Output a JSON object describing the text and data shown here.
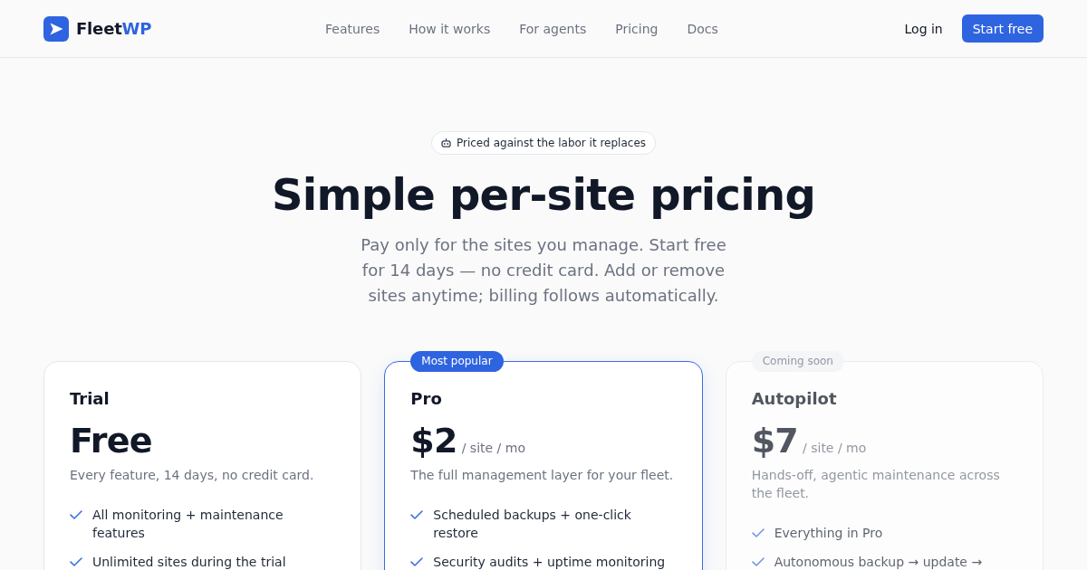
{
  "header": {
    "brand": {
      "name": "Fleet",
      "accent": "WP"
    },
    "nav_links": [
      "Features",
      "How it works",
      "For agents",
      "Pricing",
      "Docs"
    ],
    "login": "Log in",
    "cta": "Start free"
  },
  "hero": {
    "badge": "Priced against the labor it replaces",
    "title": "Simple per-site pricing",
    "subtitle": "Pay only for the sites you manage. Start free for 14 days — no credit card. Add or remove sites anytime; billing follows automatically."
  },
  "plans": [
    {
      "name": "Trial",
      "price": "Free",
      "description": "Every feature, 14 days, no credit card.",
      "featured": false,
      "dimmed": false,
      "features": [
        "All monitoring + maintenance features",
        "Unlimited sites during the trial"
      ]
    },
    {
      "name": "Pro",
      "badge": {
        "text": "Most popular",
        "kind": "accent"
      },
      "price": "$2",
      "period": "/ site / mo",
      "description": "The full management layer for your fleet.",
      "featured": true,
      "dimmed": false,
      "features": [
        "Scheduled backups + one-click restore",
        "Security audits + uptime monitoring"
      ]
    },
    {
      "name": "Autopilot",
      "badge": {
        "text": "Coming soon",
        "kind": "muted"
      },
      "price": "$7",
      "period": "/ site / mo",
      "description": "Hands-off, agentic maintenance across the fleet.",
      "featured": false,
      "dimmed": true,
      "features": [
        "Everything in Pro",
        "Autonomous backup → update →"
      ]
    }
  ]
}
